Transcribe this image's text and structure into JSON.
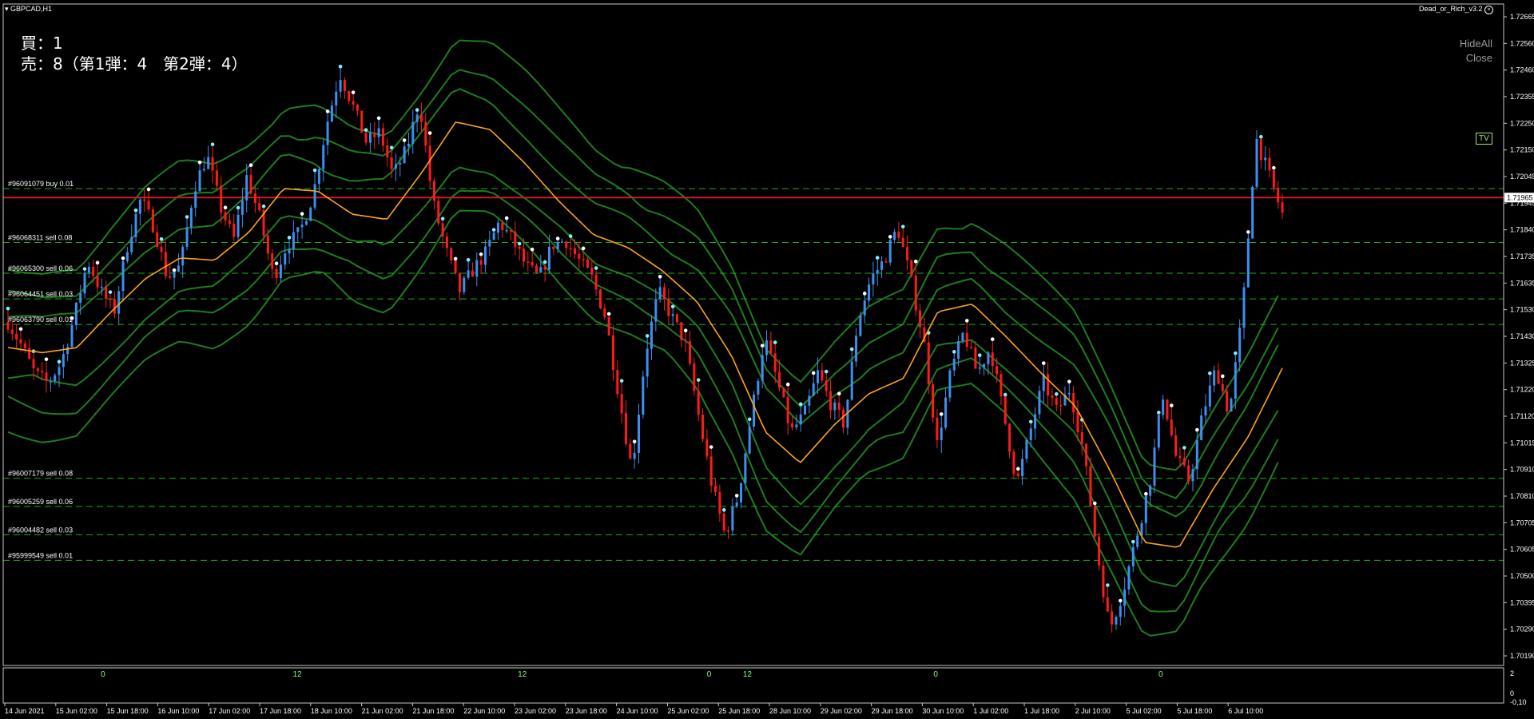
{
  "window": {
    "symbol_title": "GBPCAD,H1",
    "indicator_name": "Dead_or_Rich_v3.2",
    "buttons": {
      "hide_all": "HideAll",
      "close": "Close"
    },
    "tv_badge": "TV"
  },
  "info_panel": {
    "buy_line": "買：1",
    "sell_line": "売：8（第1弾：4　第2弾：4）"
  },
  "colors": {
    "background": "#000000",
    "bull_candle": "#3d8ff0",
    "bear_candle": "#ff1a1a",
    "bollinger": "#1e7d1e",
    "ma": "#ffa31a",
    "order_line": "#1bb01b",
    "bid_line": "#cc1d1d",
    "price_label_bg": "#d21f1f"
  },
  "chart_data": {
    "type": "line",
    "title": "",
    "y_ticks": [
      "1.72665",
      "1.72560",
      "1.72460",
      "1.72355",
      "1.72250",
      "1.72150",
      "1.72045",
      "1.71945",
      "1.71840",
      "1.71735",
      "1.71635",
      "1.71530",
      "1.71430",
      "1.71325",
      "1.71220",
      "1.71120",
      "1.71015",
      "1.70910",
      "1.70810",
      "1.70705",
      "1.70605",
      "1.70500",
      "1.70395",
      "1.70290",
      "1.70190"
    ],
    "ylim": [
      1.7014,
      1.7272
    ],
    "current_price": "1.71965",
    "current_price_value": 1.71965,
    "x_ticks": [
      "14 Jun 2021",
      "15 Jun 02:00",
      "15 Jun 18:00",
      "16 Jun 10:00",
      "17 Jun 02:00",
      "17 Jun 18:00",
      "18 Jun 10:00",
      "21 Jun 02:00",
      "21 Jun 18:00",
      "22 Jun 10:00",
      "23 Jun 02:00",
      "23 Jun 18:00",
      "24 Jun 10:00",
      "25 Jun 02:00",
      "25 Jun 18:00",
      "28 Jun 10:00",
      "29 Jun 02:00",
      "29 Jun 18:00",
      "30 Jun 10:00",
      "1 Jul 02:00",
      "1 Jul 18:00",
      "2 Jul 10:00",
      "5 Jul 02:00",
      "5 Jul 18:00",
      "6 Jul 10:00"
    ],
    "close_path": [
      1.7148,
      1.7139,
      1.7128,
      1.7124,
      1.7132,
      1.715,
      1.7172,
      1.716,
      1.7152,
      1.7178,
      1.7196,
      1.7185,
      1.7165,
      1.717,
      1.72,
      1.7213,
      1.7193,
      1.718,
      1.7205,
      1.7188,
      1.7165,
      1.7178,
      1.7183,
      1.7198,
      1.7225,
      1.7245,
      1.7232,
      1.7218,
      1.7222,
      1.7205,
      1.7215,
      1.7234,
      1.7195,
      1.7176,
      1.716,
      1.7168,
      1.7175,
      1.7187,
      1.718,
      1.717,
      1.7165,
      1.7178,
      1.718,
      1.7172,
      1.7165,
      1.715,
      1.712,
      1.709,
      1.7135,
      1.716,
      1.715,
      1.714,
      1.7112,
      1.7085,
      1.7065,
      1.708,
      1.7112,
      1.7142,
      1.7124,
      1.7105,
      1.7112,
      1.7128,
      1.7116,
      1.7108,
      1.7148,
      1.7165,
      1.7172,
      1.7185,
      1.7165,
      1.714,
      1.71,
      1.7128,
      1.7144,
      1.7128,
      1.7138,
      1.7112,
      1.7085,
      1.7105,
      1.7125,
      1.7113,
      1.7122,
      1.7098,
      1.706,
      1.7028,
      1.7043,
      1.7064,
      1.7085,
      1.712,
      1.7095,
      1.7086,
      1.7112,
      1.713,
      1.7112,
      1.7152,
      1.722,
      1.7205,
      1.719
    ],
    "ma_path": [
      1.7138,
      1.7136,
      1.7138,
      1.7152,
      1.7165,
      1.7173,
      1.7172,
      1.7183,
      1.72,
      1.7199,
      1.719,
      1.7188,
      1.7206,
      1.7226,
      1.7223,
      1.721,
      1.7195,
      1.7182,
      1.7177,
      1.7168,
      1.7156,
      1.7135,
      1.7105,
      1.7093,
      1.7108,
      1.712,
      1.7126,
      1.7152,
      1.7155,
      1.7142,
      1.7128,
      1.7115,
      1.709,
      1.7062,
      1.706,
      1.7083,
      1.7103,
      1.713
    ],
    "series": [],
    "order_lines": [
      {
        "label": "#96091079 buy 0.01",
        "price": 1.72
      },
      {
        "label": "#96068311 sell 0.08",
        "price": 1.7179
      },
      {
        "label": "#96065300 sell 0.06",
        "price": 1.7167
      },
      {
        "label": "#96064451 sell 0.03",
        "price": 1.7157
      },
      {
        "label": "#96063790 sell 0.01",
        "price": 1.7147
      },
      {
        "label": "#96007179 sell 0.08",
        "price": 1.7087
      },
      {
        "label": "#96005259 sell 0.06",
        "price": 1.7076
      },
      {
        "label": "#96004482 sell 0.03",
        "price": 1.7065
      },
      {
        "label": "#95999549 sell 0.01",
        "price": 1.7055
      }
    ],
    "sub_window": {
      "ticks": [
        "2",
        "0",
        "-0,10"
      ],
      "markers": [
        {
          "text": "0",
          "x_frac": 0.065
        },
        {
          "text": "12",
          "x_frac": 0.193
        },
        {
          "text": "12",
          "x_frac": 0.343
        },
        {
          "text": "0",
          "x_frac": 0.469
        },
        {
          "text": "12",
          "x_frac": 0.493
        },
        {
          "text": "0",
          "x_frac": 0.62
        },
        {
          "text": "0",
          "x_frac": 0.77
        }
      ]
    },
    "grid": false,
    "xlabel": "",
    "ylabel": ""
  }
}
